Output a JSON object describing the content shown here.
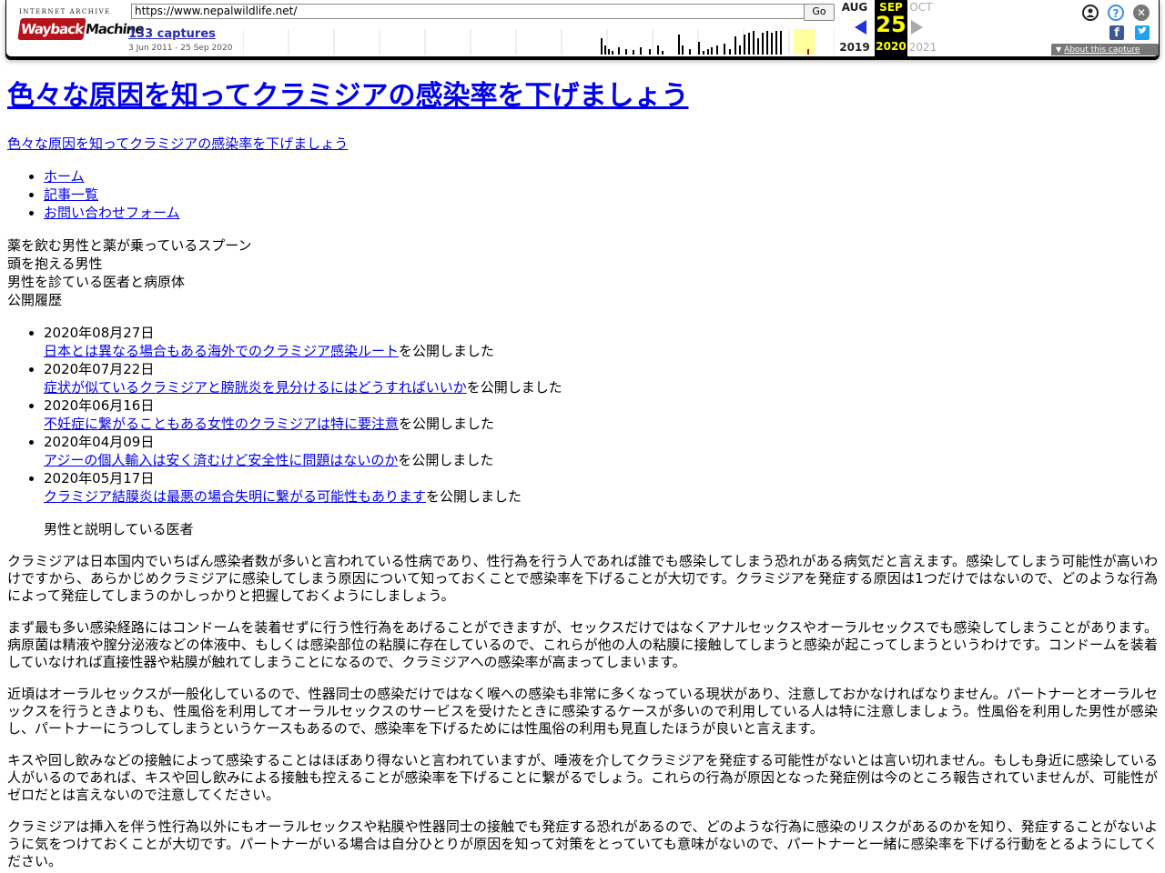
{
  "wayback": {
    "logo_top": "INTERNET ARCHIVE",
    "logo_wayback": "Wayback",
    "logo_machine": "Machine",
    "url": "https://www.nepalwildlife.net/",
    "go_label": "Go",
    "captures": "133 captures",
    "range": "3 Jun 2011 - 25 Sep 2020",
    "prev_month": "AUG",
    "prev_year": "2019",
    "current_month": "SEP",
    "current_day": "25",
    "current_year": "2020",
    "next_month": "OCT",
    "next_year": "2021",
    "about_label": "About this capture",
    "accent": "#ffff00",
    "icons": [
      "user-icon",
      "help-icon",
      "close-icon",
      "facebook-icon",
      "twitter-icon"
    ],
    "sparkline_capture_counts": [
      0,
      0,
      0,
      0,
      0,
      0,
      0,
      0,
      0,
      0,
      0,
      0,
      0,
      0,
      0,
      0,
      0,
      0,
      0,
      0,
      0,
      0,
      0,
      0,
      0,
      0,
      0,
      0,
      0,
      0,
      0,
      0,
      0,
      0,
      0,
      0,
      0,
      0,
      0,
      0,
      0,
      0,
      0,
      0,
      0,
      0,
      0,
      0,
      0,
      0,
      0,
      0,
      0,
      0,
      0,
      0,
      0,
      0,
      0,
      0,
      0,
      0,
      0,
      0,
      0,
      0,
      0,
      0,
      0,
      0,
      0,
      0,
      0,
      0,
      0,
      0,
      0,
      0,
      0,
      0,
      0,
      0,
      0,
      0,
      0,
      0,
      0,
      0,
      0,
      0,
      0,
      0,
      0,
      0,
      0,
      0,
      0,
      0,
      0,
      0,
      0,
      0,
      0,
      0,
      0,
      0,
      0,
      0,
      0,
      0,
      0,
      0,
      0,
      0,
      0,
      0,
      0,
      0,
      0,
      0,
      0,
      0,
      0,
      0,
      0,
      0,
      0,
      0,
      0,
      0,
      0,
      0,
      0,
      0,
      0,
      0,
      0,
      0,
      0,
      0,
      0,
      0,
      0,
      0,
      0,
      0,
      0,
      0,
      0,
      0,
      0,
      0,
      0,
      0,
      0,
      0,
      0,
      0,
      0,
      0,
      0,
      0,
      0,
      0,
      0,
      0,
      0,
      0,
      0,
      0,
      0,
      0,
      0,
      0,
      0,
      0,
      0,
      0,
      0,
      0,
      0,
      0,
      0,
      0,
      0,
      0,
      0,
      0,
      0,
      0,
      0,
      0,
      0,
      0,
      0,
      0,
      0,
      0,
      0,
      0,
      0,
      0,
      0,
      0,
      0,
      0,
      0,
      0,
      0,
      0,
      0,
      0,
      0,
      0,
      0,
      0,
      0,
      0,
      0,
      0,
      0,
      0,
      0,
      0,
      0,
      0,
      0,
      0,
      0,
      0,
      0,
      0,
      0,
      0,
      0,
      0,
      0,
      0,
      0,
      0,
      0,
      0,
      0,
      0,
      0,
      0,
      0,
      0,
      0,
      0,
      0,
      0,
      0,
      0,
      0,
      0,
      0,
      0,
      0,
      0,
      0,
      0,
      0,
      0,
      0,
      0,
      0,
      0,
      0,
      0,
      0,
      0,
      0,
      0,
      0,
      0,
      0,
      0,
      0,
      0,
      0,
      0,
      0,
      0,
      0,
      0,
      0,
      0,
      0,
      0,
      0,
      0,
      0,
      0,
      0,
      0,
      0,
      0,
      0,
      0,
      0,
      0,
      0,
      0,
      0,
      0,
      0,
      0,
      0,
      0,
      0,
      0,
      0,
      0,
      0,
      0,
      0,
      0,
      0,
      0,
      0,
      0,
      0,
      0,
      0,
      0,
      0,
      0,
      0,
      0,
      0,
      0,
      0,
      0,
      0,
      0,
      0,
      0,
      0,
      0,
      0,
      0,
      0,
      0,
      0,
      0,
      0,
      0,
      0,
      0,
      0,
      0,
      0,
      0,
      0,
      0,
      0,
      0,
      0,
      0,
      0,
      0,
      0,
      0,
      0,
      0,
      0,
      0,
      0,
      0,
      0,
      0,
      0,
      0,
      0,
      0,
      0,
      0,
      0,
      0,
      0,
      0,
      0,
      0,
      0,
      0,
      0,
      0,
      0,
      0,
      0,
      0,
      0,
      0,
      0,
      0,
      0,
      0,
      0,
      0,
      0,
      0,
      0,
      0,
      0,
      0,
      0,
      0,
      0,
      0,
      0,
      0,
      0,
      0,
      0,
      0,
      0,
      0,
      0,
      0,
      0,
      0,
      0,
      0,
      0,
      0,
      0,
      0,
      0,
      0,
      0,
      0,
      0,
      0,
      0,
      0,
      0,
      0,
      0,
      0,
      0,
      0,
      0,
      0,
      0,
      0,
      0,
      0,
      0,
      0,
      0,
      0,
      0,
      0,
      0,
      0,
      0,
      0,
      0,
      0,
      0,
      0,
      0,
      0,
      0,
      0,
      0,
      0,
      0,
      0,
      0,
      0,
      0,
      0,
      0,
      0,
      0,
      0,
      0,
      0,
      0,
      0,
      0,
      0,
      0,
      0,
      0,
      0,
      0,
      0,
      0,
      0,
      0,
      0,
      0,
      0,
      0,
      0,
      0,
      0,
      0,
      0,
      0,
      0,
      0,
      0,
      0,
      0,
      0,
      0,
      0,
      0,
      0,
      0,
      0,
      0,
      0,
      0,
      0,
      0,
      0,
      0,
      0,
      0,
      0,
      0,
      0,
      0,
      0,
      0,
      0,
      0,
      0,
      0,
      0,
      0,
      0,
      0,
      0,
      0,
      0,
      0,
      0,
      0,
      0,
      0,
      0,
      0,
      0,
      0,
      0,
      0,
      0,
      0,
      0,
      0,
      0,
      0,
      0,
      0,
      0,
      0,
      0,
      0,
      0,
      0,
      0,
      0,
      0,
      0,
      0,
      0,
      0,
      0,
      0,
      0,
      0,
      0,
      0,
      0,
      0,
      0,
      0,
      0,
      0,
      0,
      0,
      0,
      0,
      0,
      0,
      0,
      0,
      0,
      0,
      0,
      0,
      0,
      0,
      0,
      0,
      0,
      0,
      0,
      0,
      0,
      0,
      0,
      0,
      0,
      0,
      0,
      0,
      0,
      0,
      0,
      0,
      0,
      0,
      0,
      0,
      0,
      0,
      0,
      0,
      0,
      0,
      0,
      0,
      0,
      0,
      0,
      0,
      0,
      0,
      0,
      0,
      0,
      0,
      0,
      0,
      0,
      0,
      0,
      0,
      0,
      0,
      0,
      0,
      0,
      0,
      0,
      0,
      0,
      0,
      0,
      0,
      0,
      0,
      0,
      0,
      0,
      0,
      0,
      0,
      0,
      0,
      0,
      0,
      0,
      0,
      0,
      0,
      0,
      0,
      0,
      0,
      0,
      0,
      0,
      0,
      0,
      0,
      0,
      0,
      0,
      0,
      0,
      0,
      0,
      0,
      0,
      0,
      0,
      0,
      0,
      0,
      0,
      0,
      0,
      0,
      0,
      0,
      0,
      0,
      0,
      0,
      0,
      0,
      0,
      0,
      0,
      0,
      0,
      0,
      0,
      0,
      0,
      0,
      0,
      0,
      0,
      0,
      0,
      0,
      0,
      0,
      0,
      0,
      0,
      0,
      0,
      0,
      0,
      0,
      0,
      0,
      0,
      0,
      0,
      0,
      0,
      0,
      0,
      0,
      0,
      0,
      0,
      0,
      0,
      0,
      0,
      0,
      0,
      0,
      0,
      0,
      0,
      0,
      0,
      0,
      0,
      0,
      0,
      0,
      0,
      0,
      0,
      0,
      0,
      0,
      0,
      0,
      0,
      0,
      0,
      0,
      0,
      0,
      0,
      0,
      0
    ]
  },
  "site": {
    "title": "色々な原因を知ってクラミジアの感染率を下げましょう",
    "tagline": "色々な原因を知ってクラミジアの感染率を下げましょう",
    "nav": [
      "ホーム",
      "記事一覧",
      "お問い合わせフォーム"
    ],
    "image_alts": [
      "薬を飲む男性と薬が乗っているスプーン",
      "頭を抱える男性",
      "男性を診ている医者と病原体"
    ],
    "history_title": "公開履歴",
    "history_suffix": "を公開しました",
    "history": [
      {
        "date": "2020年08月27日",
        "title": "日本とは異なる場合もある海外でのクラミジア感染ルート"
      },
      {
        "date": "2020年07月22日",
        "title": "症状が似ているクラミジアと膀胱炎を見分けるにはどうすればいいか"
      },
      {
        "date": "2020年06月16日",
        "title": "不妊症に繋がることもある女性のクラミジアは特に要注意"
      },
      {
        "date": "2020年04月09日",
        "title": "アジーの個人輸入は安く済むけど安全性に問題はないのか"
      },
      {
        "date": "2020年05月17日",
        "title": "クラミジア結膜炎は最悪の場合失明に繋がる可能性もあります"
      }
    ],
    "illustration_alt": "男性と説明している医者",
    "paragraphs": [
      "クラミジアは日本国内でいちばん感染者数が多いと言われている性病であり、性行為を行う人であれば誰でも感染してしまう恐れがある病気だと言えます。感染してしまう可能性が高いわけですから、あらかじめクラミジアに感染してしまう原因について知っておくことで感染率を下げることが大切です。クラミジアを発症する原因は1つだけではないので、どのような行為によって発症してしまうのかしっかりと把握しておくようにしましょう。",
      "まず最も多い感染経路にはコンドームを装着せずに行う性行為をあげることができますが、セックスだけではなくアナルセックスやオーラルセックスでも感染してしまうことがあります。病原菌は精液や膣分泌液などの体液中、もしくは感染部位の粘膜に存在しているので、これらが他の人の粘膜に接触してしまうと感染が起こってしまうというわけです。コンドームを装着していなければ直接性器や粘膜が触れてしまうことになるので、クラミジアへの感染率が高まってしまいます。",
      "近頃はオーラルセックスが一般化しているので、性器同士の感染だけではなく喉への感染も非常に多くなっている現状があり、注意しておかなければなりません。パートナーとオーラルセックスを行うときよりも、性風俗を利用してオーラルセックスのサービスを受けたときに感染するケースが多いので利用している人は特に注意しましょう。性風俗を利用した男性が感染し、パートナーにうつしてしまうというケースもあるので、感染率を下げるためには性風俗の利用も見直したほうが良いと言えます。",
      "キスや回し飲みなどの接触によって感染することはほぼあり得ないと言われていますが、唾液を介してクラミジアを発症する可能性がないとは言い切れません。もしも身近に感染している人がいるのであれば、キスや回し飲みによる接触も控えることが感染率を下げることに繋がるでしょう。これらの行為が原因となった発症例は今のところ報告されていませんが、可能性がゼロだとは言えないので注意してください。",
      "クラミジアは挿入を伴う性行為以外にもオーラルセックスや粘膜や性器同士の接触でも発症する恐れがあるので、どのような行為に感染のリスクがあるのかを知り、発症することがないように気をつけておくことが大切です。パートナーがいる場合は自分ひとりが原因を知って対策をとっていても意味がないので、パートナーと一緒に感染率を下げる行動をとるようにしてください。"
    ]
  }
}
